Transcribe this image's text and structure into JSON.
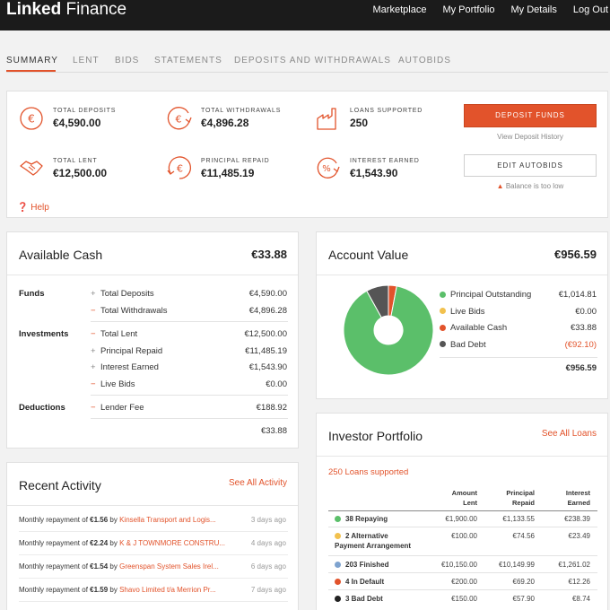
{
  "brand": {
    "bold": "Linked",
    "light": " Finance"
  },
  "topnav": [
    {
      "label": "Marketplace"
    },
    {
      "label": "My Portfolio"
    },
    {
      "label": "My Details"
    },
    {
      "label": "Log Out"
    }
  ],
  "tabs": [
    {
      "label": "SUMMARY"
    },
    {
      "label": "LENT"
    },
    {
      "label": "BIDS"
    },
    {
      "label": "STATEMENTS"
    },
    {
      "label": "DEPOSITS AND WITHDRAWALS"
    },
    {
      "label": "AUTOBIDS"
    }
  ],
  "summary": {
    "stats": [
      {
        "label": "TOTAL DEPOSITS",
        "value": "€4,590.00",
        "icon": "euro-circle-icon"
      },
      {
        "label": "TOTAL WITHDRAWALS",
        "value": "€4,896.28",
        "icon": "euro-withdraw-icon"
      },
      {
        "label": "LOANS SUPPORTED",
        "value": "250",
        "icon": "factory-icon"
      },
      {
        "label": "TOTAL LENT",
        "value": "€12,500.00",
        "icon": "handshake-icon"
      },
      {
        "label": "PRINCIPAL REPAID",
        "value": "€11,485.19",
        "icon": "euro-repay-icon"
      },
      {
        "label": "INTEREST EARNED",
        "value": "€1,543.90",
        "icon": "percent-circle-icon"
      }
    ],
    "deposit_button": "DEPOSIT FUNDS",
    "deposit_history": "View Deposit History",
    "autobids_button": "EDIT AUTOBIDS",
    "balance_warning": "Balance is too low",
    "help": "Help"
  },
  "available_cash": {
    "title": "Available Cash",
    "amount": "€33.88",
    "funds_label": "Funds",
    "investments_label": "Investments",
    "deductions_label": "Deductions",
    "rows": [
      {
        "sign": "+",
        "label": "Total Deposits",
        "value": "€4,590.00"
      },
      {
        "sign": "−",
        "label": "Total Withdrawals",
        "value": "€4,896.28"
      },
      {
        "sign": "−",
        "label": "Total Lent",
        "value": "€12,500.00"
      },
      {
        "sign": "+",
        "label": "Principal Repaid",
        "value": "€11,485.19"
      },
      {
        "sign": "+",
        "label": "Interest Earned",
        "value": "€1,543.90"
      },
      {
        "sign": "−",
        "label": "Live Bids",
        "value": "€0.00"
      },
      {
        "sign": "−",
        "label": "Lender Fee",
        "value": "€188.92"
      }
    ],
    "total": "€33.88"
  },
  "account_value": {
    "title": "Account Value",
    "amount": "€956.59",
    "total": "€956.59",
    "chart_data": {
      "type": "pie",
      "donut": true,
      "slices": [
        {
          "name": "Principal Outstanding",
          "value": 1014.81,
          "label": "€1,014.81",
          "color": "#5bbf6a"
        },
        {
          "name": "Live Bids",
          "value": 0.0,
          "label": "€0.00",
          "color": "#f2c14e"
        },
        {
          "name": "Available Cash",
          "value": 33.88,
          "label": "€33.88",
          "color": "#e2532b"
        },
        {
          "name": "Bad Debt",
          "value": 92.1,
          "label": "(€92.10)",
          "color": "#555555",
          "negative": true
        }
      ]
    }
  },
  "recent_activity": {
    "title": "Recent Activity",
    "see_all": "See All Activity",
    "items": [
      {
        "prefix": "Monthly repayment of ",
        "amount": "€1.56",
        "by": " by ",
        "company": "Kinsella Transport and Logis...",
        "ago": "3 days ago"
      },
      {
        "prefix": "Monthly repayment of ",
        "amount": "€2.24",
        "by": " by ",
        "company": "K & J TOWNMORE CONSTRU...",
        "ago": "4 days ago"
      },
      {
        "prefix": "Monthly repayment of ",
        "amount": "€1.54",
        "by": " by ",
        "company": "Greenspan System Sales Irel...",
        "ago": "6 days ago"
      },
      {
        "prefix": "Monthly repayment of ",
        "amount": "€1.59",
        "by": " by ",
        "company": "Shavo Limited t/a Merrion Pr...",
        "ago": "7 days ago"
      }
    ]
  },
  "portfolio": {
    "title": "Investor Portfolio",
    "see_all": "See All Loans",
    "loans_supported": "250 Loans supported",
    "headers": {
      "lent": [
        "Amount",
        "Lent"
      ],
      "repaid": [
        "Principal",
        "Repaid"
      ],
      "earned": [
        "Interest",
        "Earned"
      ]
    },
    "rows": [
      {
        "label": "38 Repaying",
        "color": "#5bbf6a",
        "lent": "€1,900.00",
        "repaid": "€1,133.55",
        "earned": "€238.39"
      },
      {
        "label": "2 Alternative",
        "label2": "Payment Arrangement",
        "color": "#f2c14e",
        "lent": "€100.00",
        "repaid": "€74.56",
        "earned": "€23.49"
      },
      {
        "label": "203 Finished",
        "color": "#7ea3cf",
        "lent": "€10,150.00",
        "repaid": "€10,149.99",
        "earned": "€1,261.02"
      },
      {
        "label": "4 In Default",
        "color": "#e2532b",
        "lent": "€200.00",
        "repaid": "€69.20",
        "earned": "€12.26"
      },
      {
        "label": "3 Bad Debt",
        "color": "#222222",
        "lent": "€150.00",
        "repaid": "€57.90",
        "earned": "€8.74"
      }
    ]
  }
}
